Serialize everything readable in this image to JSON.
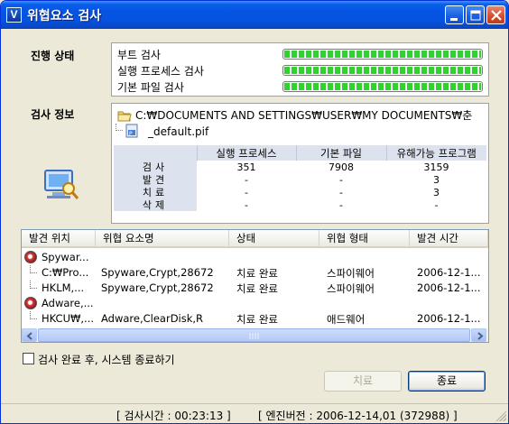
{
  "window": {
    "title": "위협요소 검사",
    "app_icon_letter": "V"
  },
  "progress_section": {
    "label": "진행 상태",
    "rows": [
      {
        "label": "부트 검사",
        "progress": 1.0
      },
      {
        "label": "실행 프로세스 검사",
        "progress": 1.0
      },
      {
        "label": "기본 파일 검사",
        "progress": 1.0
      }
    ]
  },
  "scan_info": {
    "label": "검사 정보",
    "path": "C:₩DOCUMENTS AND SETTINGS₩USER₩MY DOCUMENTS₩춘",
    "file": "_default.pif",
    "table": {
      "headers": [
        "실행 프로세스",
        "기본 파일",
        "유해가능 프로그램"
      ],
      "rows": [
        {
          "label": "검사",
          "values": [
            "351",
            "7908",
            "3159"
          ]
        },
        {
          "label": "발견",
          "values": [
            "-",
            "-",
            "3"
          ]
        },
        {
          "label": "치료",
          "values": [
            "-",
            "-",
            "3"
          ]
        },
        {
          "label": "삭제",
          "values": [
            "-",
            "-",
            "-"
          ]
        }
      ]
    }
  },
  "results_list": {
    "columns": [
      "발견 위치",
      "위협 요소명",
      "상태",
      "위협 형태",
      "발견 시간"
    ],
    "groups": [
      {
        "name": "Spywar...",
        "items": [
          [
            "C:₩Pro...",
            "Spyware,Crypt,28672",
            "치료 완료",
            "스파이웨어",
            "2006-12-1..."
          ],
          [
            "HKLM,...",
            "Spyware,Crypt,28672",
            "치료 완료",
            "스파이웨어",
            "2006-12-1..."
          ]
        ]
      },
      {
        "name": "Adware,...",
        "items": [
          [
            "HKCU₩,...",
            "Adware,ClearDisk,R",
            "치료 완료",
            "애드웨어",
            "2006-12-1..."
          ]
        ]
      }
    ]
  },
  "shutdown_option": {
    "label": "검사 완료 후, 시스템 종료하기",
    "checked": false
  },
  "buttons": {
    "treat": "치료",
    "exit": "종료"
  },
  "statusbar": {
    "scan_time": "[ 검사시간 : 00:23:13 ]",
    "engine_version": "[ 엔진버전 : 2006-12-14,01 (372988) ]"
  }
}
